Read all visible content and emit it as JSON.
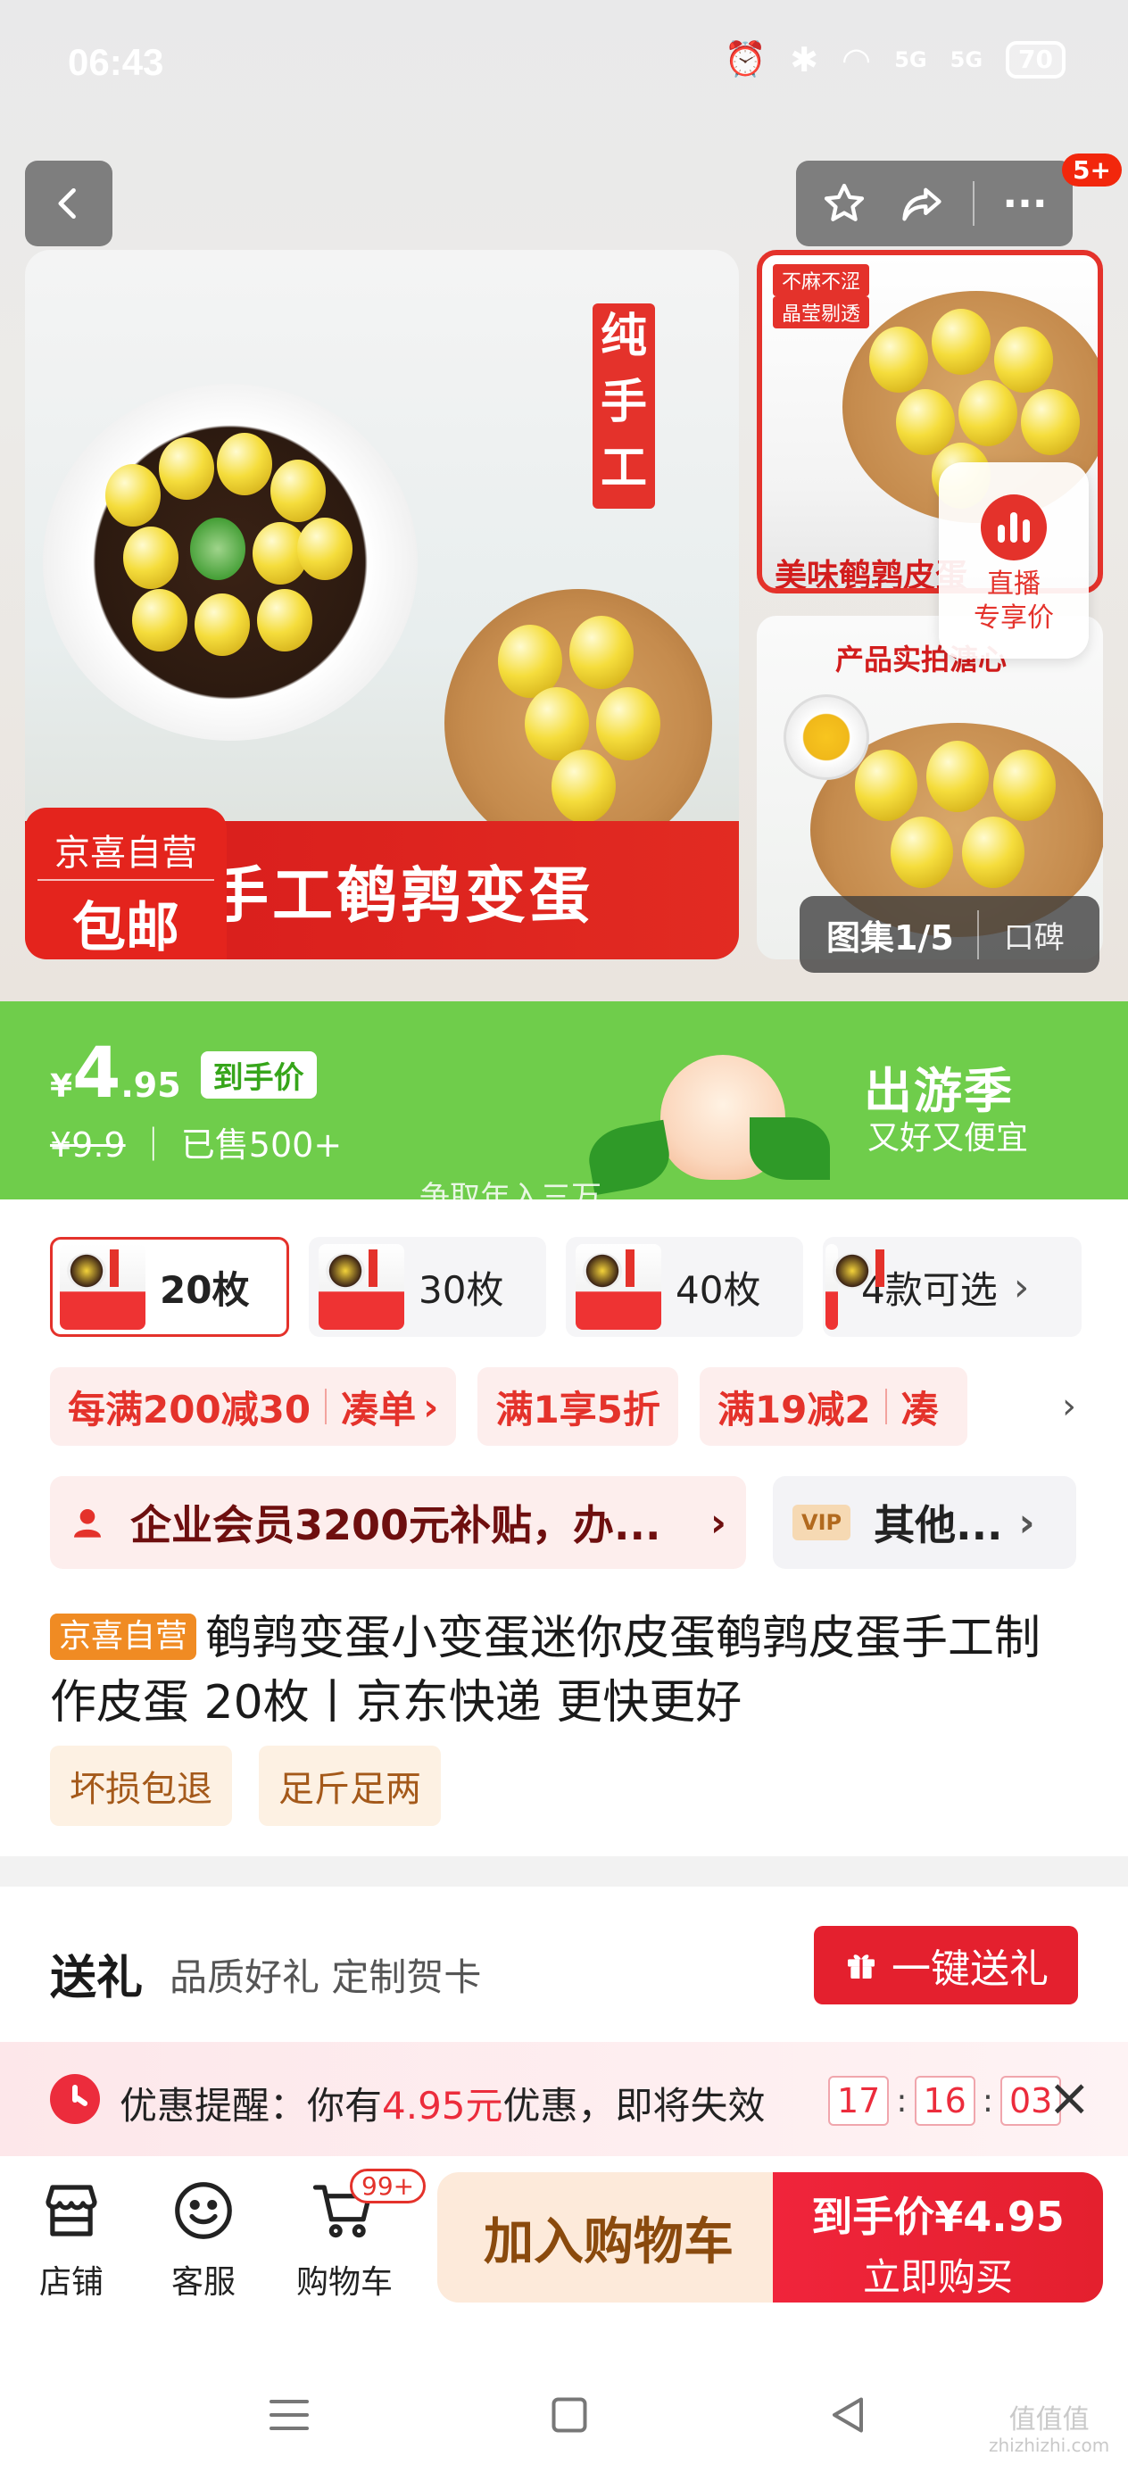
{
  "status_bar": {
    "time": "06:43",
    "battery": "70",
    "signal1": "5G",
    "signal2": "5G"
  },
  "header": {
    "badge": "5+"
  },
  "gallery": {
    "stamp_text": "纯手工",
    "banner_text": "手工鹌鹑变蛋",
    "self_tag_line1": "京喜自营",
    "self_tag_line2": "包邮",
    "side1_tag1": "不麻不涩",
    "side1_tag2": "晶莹剔透",
    "side1_title": "美味鹌鹑皮蛋",
    "side2_title": "产品实拍溏心",
    "live_line1": "直播",
    "live_line2": "专享价",
    "counter": "图集1/5",
    "review_label": "口碑"
  },
  "price": {
    "yen": "¥",
    "integer": "4",
    "decimal": ".95",
    "tag": "到手价",
    "original": "¥9.9",
    "sold": "已售500+",
    "promo_title": "出游季",
    "promo_sub": "又好又便宜",
    "faint_text": "争取年入三万"
  },
  "specs": [
    {
      "label": "20枚",
      "active": true
    },
    {
      "label": "30枚",
      "active": false
    },
    {
      "label": "40枚",
      "active": false
    }
  ],
  "specs_more": "4款可选",
  "coupons": {
    "c1_main": "每满200减30",
    "c1_action": "凑单",
    "c2": "满1享5折",
    "c3_main": "满19减2",
    "c3_action": "凑"
  },
  "member": {
    "text": "企业会员3200元补贴，办...",
    "vip_badge": "VIP",
    "other": "其他..."
  },
  "product": {
    "self_tag": "京喜自营",
    "title": "鹌鹑变蛋小变蛋迷你皮蛋鹌鹑皮蛋手工制作皮蛋 20枚丨京东快递 更快更好",
    "tags": [
      "坏损包退",
      "足斤足两"
    ]
  },
  "gift": {
    "title": "送礼",
    "desc": "品质好礼 定制贺卡",
    "button": "一键送礼"
  },
  "reminder": {
    "prefix": "优惠提醒：你有",
    "amount": "4.95元",
    "suffix": "优惠，即将失效",
    "hh": "17",
    "mm": "16",
    "ss": "03"
  },
  "actionbar": {
    "store": "店铺",
    "service": "客服",
    "cart": "购物车",
    "cart_badge": "99+",
    "add_to_cart": "加入购物车",
    "buy_line1": "到手价¥4.95",
    "buy_line2": "立即购买"
  },
  "watermark": {
    "line1": "值值值",
    "line2": "zhizhizhi.com"
  },
  "colors": {
    "accent": "#e4322b",
    "promo_green": "#6fcd4b",
    "self_tag": "#f08b23"
  }
}
